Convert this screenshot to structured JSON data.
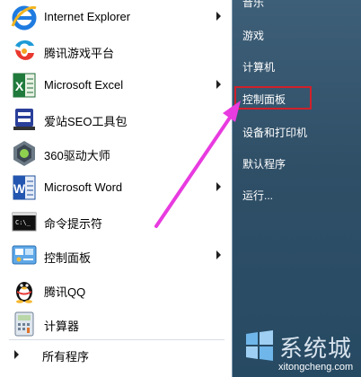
{
  "start_menu": {
    "programs": [
      {
        "label": "Internet Explorer",
        "icon": "internet-explorer-icon",
        "has_submenu": true
      },
      {
        "label": "腾讯游戏平台",
        "icon": "tencent-game-icon",
        "has_submenu": false
      },
      {
        "label": "Microsoft Excel",
        "icon": "excel-icon",
        "has_submenu": true
      },
      {
        "label": "爱站SEO工具包",
        "icon": "aizhan-seo-icon",
        "has_submenu": false
      },
      {
        "label": "360驱动大师",
        "icon": "driver-master-icon",
        "has_submenu": false
      },
      {
        "label": "Microsoft Word",
        "icon": "word-icon",
        "has_submenu": true
      },
      {
        "label": "命令提示符",
        "icon": "cmd-icon",
        "has_submenu": false
      },
      {
        "label": "控制面板",
        "icon": "control-panel-icon",
        "has_submenu": true
      },
      {
        "label": "腾讯QQ",
        "icon": "qq-penguin-icon",
        "has_submenu": false
      },
      {
        "label": "计算器",
        "icon": "calculator-icon",
        "has_submenu": false
      }
    ],
    "all_programs_label": "所有程序",
    "right_items": [
      {
        "label": "音乐"
      },
      {
        "label": "游戏"
      },
      {
        "label": "计算机"
      },
      {
        "label": "控制面板"
      },
      {
        "label": "设备和打印机"
      },
      {
        "label": "默认程序"
      },
      {
        "label": "运行..."
      }
    ],
    "highlighted_item": "控制面板"
  },
  "colors": {
    "right_pane": "#2f4f67",
    "highlight_border": "#d0202a",
    "annotation_arrow": "#e83be0"
  },
  "watermark": {
    "text": "系统城",
    "url": "xitongcheng.com"
  }
}
